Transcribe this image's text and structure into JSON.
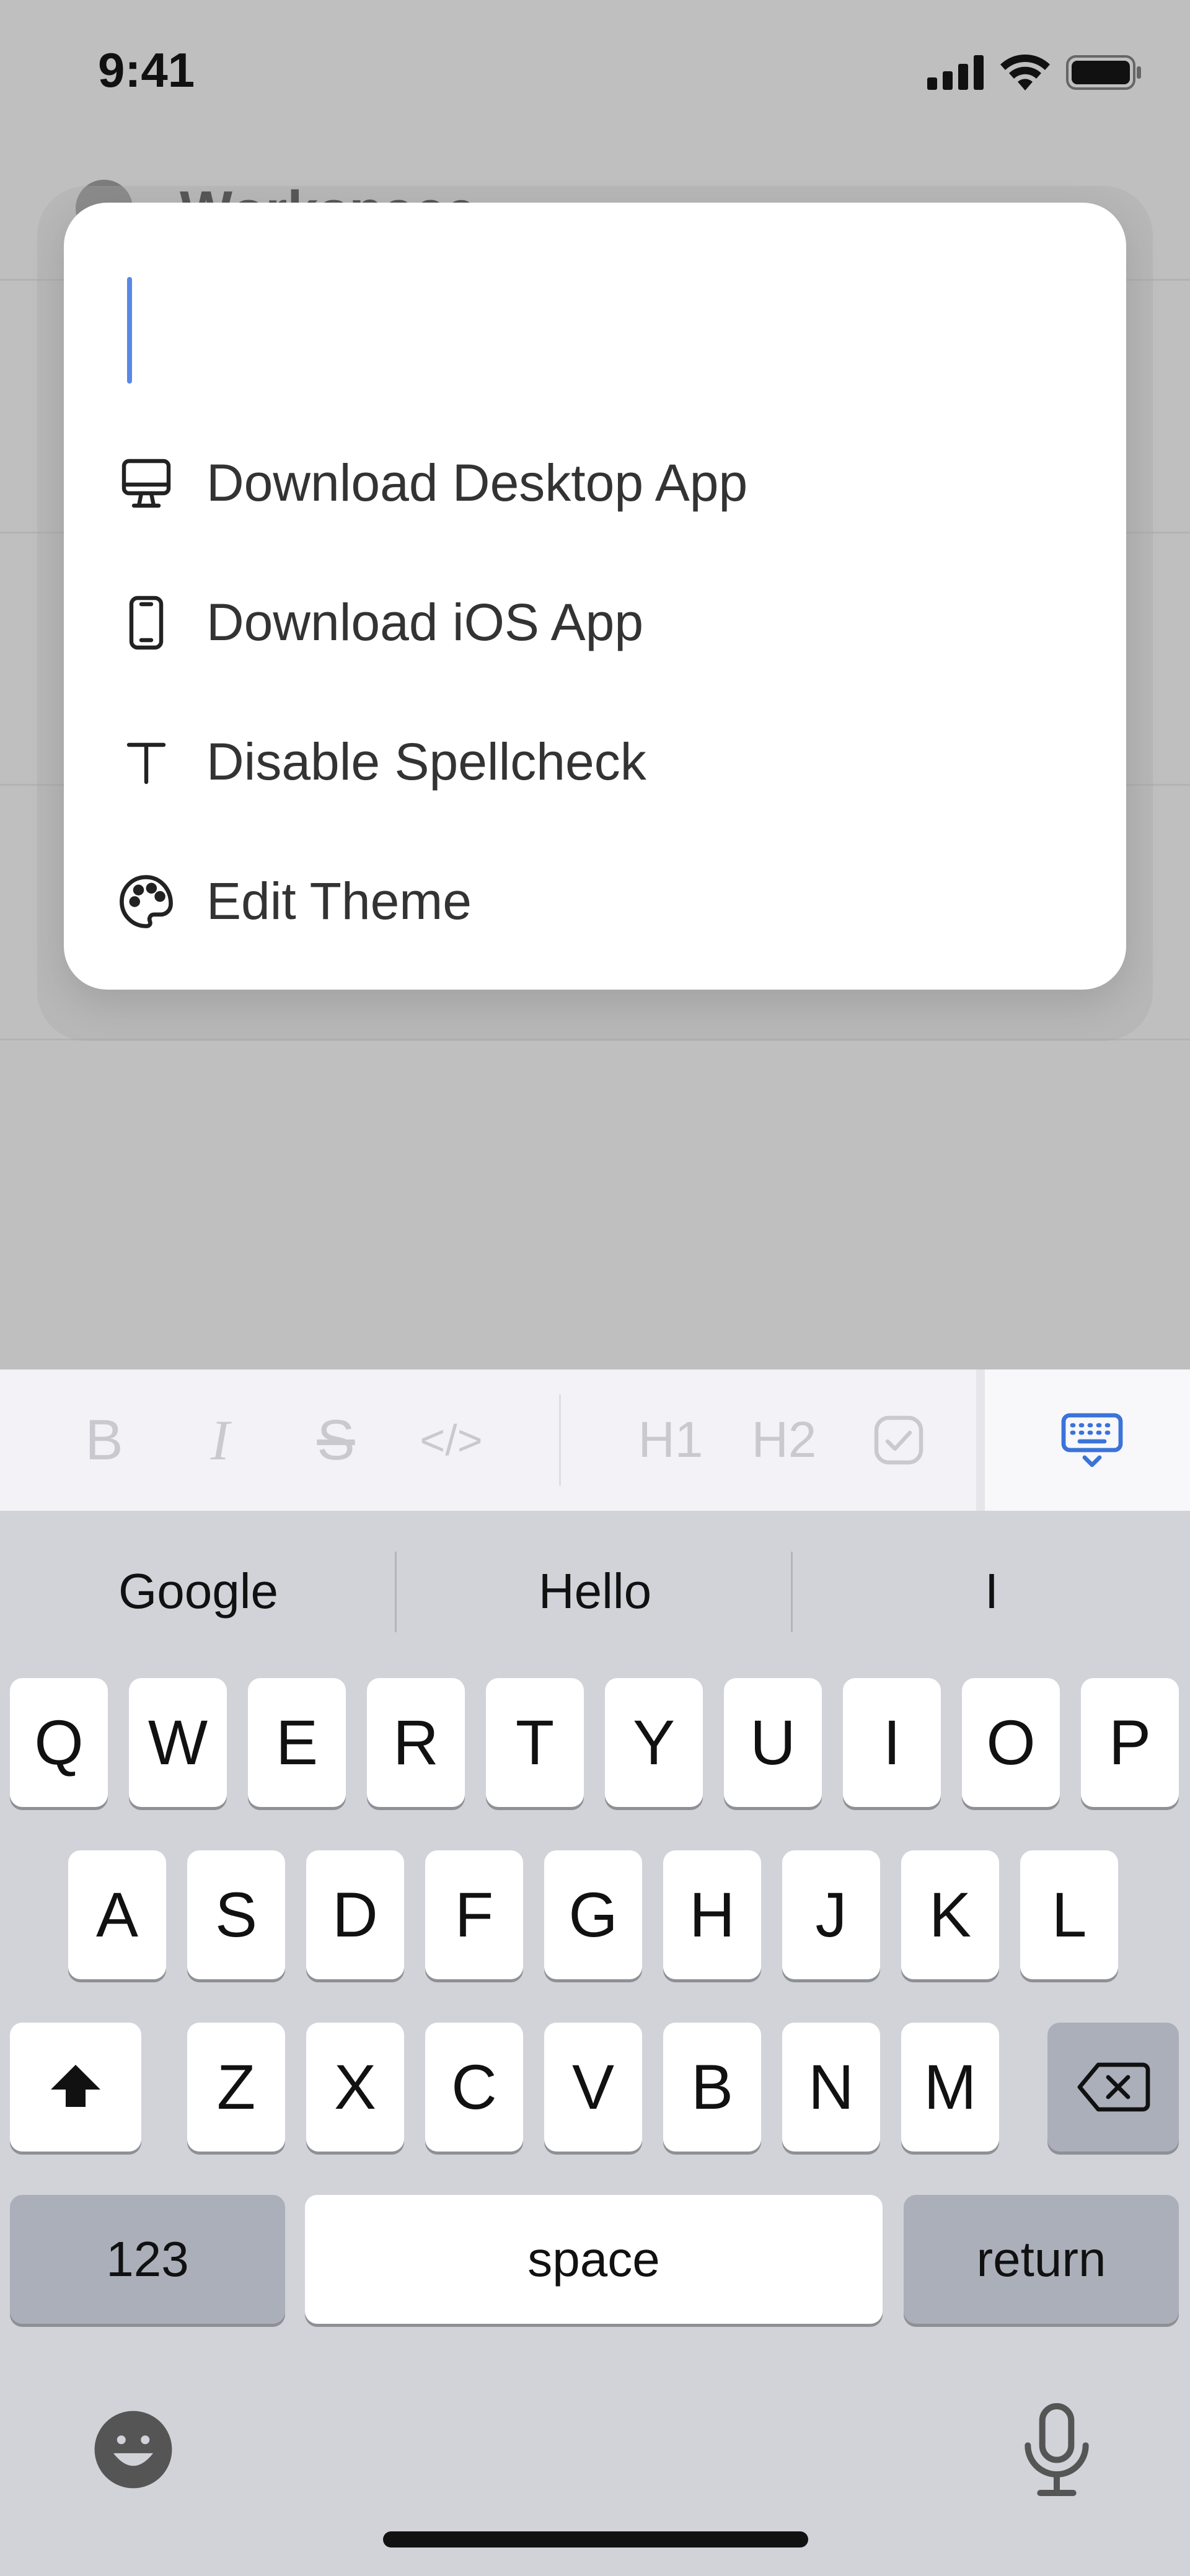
{
  "status_bar": {
    "time": "9:41"
  },
  "background_app": {
    "title": "Workspace"
  },
  "menu": {
    "items": [
      {
        "label": "Download Desktop App",
        "icon": "desktop-monitor-icon"
      },
      {
        "label": "Download iOS App",
        "icon": "mobile-phone-icon"
      },
      {
        "label": "Disable Spellcheck",
        "icon": "text-t-icon"
      },
      {
        "label": "Edit Theme",
        "icon": "palette-icon"
      }
    ]
  },
  "toolbar": {
    "bold": "B",
    "italic": "I",
    "strikethrough": "S",
    "code": "</>",
    "heading1": "H1",
    "heading2": "H2",
    "colors": {
      "inactive": "#c9c9cf",
      "accent": "#3b73d9"
    }
  },
  "keyboard": {
    "suggestions": [
      "Google",
      "Hello",
      "I"
    ],
    "row1": [
      "Q",
      "W",
      "E",
      "R",
      "T",
      "Y",
      "U",
      "I",
      "O",
      "P"
    ],
    "row2": [
      "A",
      "S",
      "D",
      "F",
      "G",
      "H",
      "J",
      "K",
      "L"
    ],
    "row3": [
      "Z",
      "X",
      "C",
      "V",
      "B",
      "N",
      "M"
    ],
    "numbers_label": "123",
    "space_label": "space",
    "return_label": "return"
  }
}
